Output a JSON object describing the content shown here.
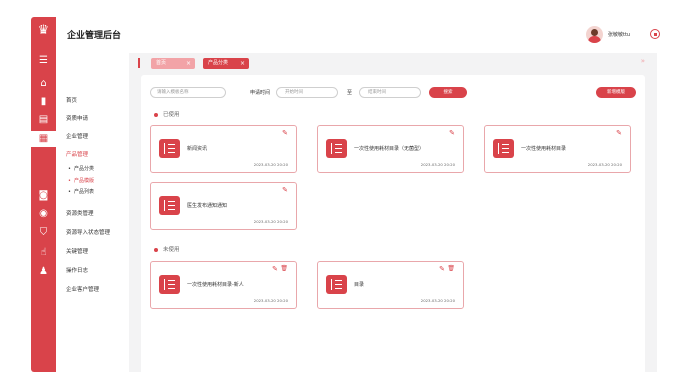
{
  "header": {
    "title": "企业管理后台",
    "username": "张敏敏ttu"
  },
  "sidebar": {
    "items": [
      {
        "label": "首页"
      },
      {
        "label": "资质申请"
      },
      {
        "label": "企业管理"
      },
      {
        "label": "产品管理"
      },
      {
        "label": "资源类管理"
      },
      {
        "label": "资源导入状态管理"
      },
      {
        "label": "关键管理"
      },
      {
        "label": "操作日志"
      },
      {
        "label": "企业客户管理"
      }
    ],
    "subitems": [
      {
        "label": "产品分类"
      },
      {
        "label": "产品模版"
      },
      {
        "label": "产品列表"
      }
    ]
  },
  "tabs": [
    {
      "label": "首页"
    },
    {
      "label": "产品分类"
    }
  ],
  "filters": {
    "search_placeholder": "请输入模板名称",
    "date_label": "申请时间",
    "date_start_placeholder": "开始时间",
    "date_sep": "至",
    "date_end_placeholder": "结束时间",
    "search_button": "搜索",
    "add_button": "新增模版"
  },
  "sections": {
    "used": "已使用",
    "unused": "未使用"
  },
  "used_cards": [
    {
      "name": "新闻资讯",
      "time": "2023-03-20 20:20"
    },
    {
      "name": "一次性使用耗材目录（无菌型）",
      "time": "2023-03-20 20:20"
    },
    {
      "name": "一次性使用耗材目录",
      "time": "2023-03-20 20:20"
    },
    {
      "name": "医生发布通知通知",
      "time": "2023-03-20 20:20"
    }
  ],
  "unused_cards": [
    {
      "name": "一次性使用耗材目录-新人",
      "time": "2023-03-20 20:20"
    },
    {
      "name": "目录",
      "time": "2023-03-20 20:20"
    }
  ],
  "colors": {
    "accent": "#d9434a",
    "tab_light": "#f2a3a7"
  }
}
